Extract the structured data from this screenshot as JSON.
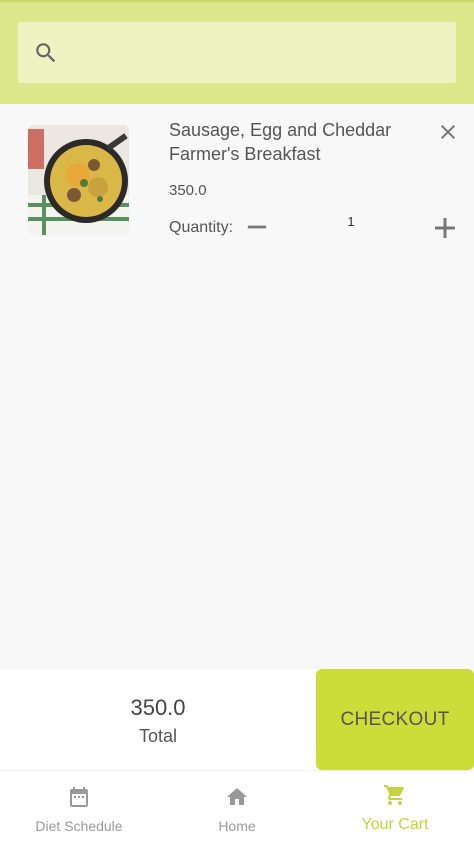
{
  "search": {
    "placeholder": "",
    "value": ""
  },
  "cart": {
    "items": [
      {
        "title": "Sausage, Egg and Cheddar Farmer's Breakfast",
        "price": "350.0",
        "quantity_label": "Quantity:",
        "quantity": "1"
      }
    ]
  },
  "checkout": {
    "total_amount": "350.0",
    "total_label": "Total",
    "button_label": "CHECKOUT"
  },
  "nav": {
    "items": [
      {
        "label": "Diet Schedule",
        "icon": "calendar-icon"
      },
      {
        "label": "Home",
        "icon": "home-icon"
      },
      {
        "label": "Your Cart",
        "icon": "cart-icon",
        "active": true
      }
    ]
  },
  "colors": {
    "header_bg": "#dde88c",
    "search_bg": "#eef3c1",
    "accent": "#cddc39",
    "active_nav": "#c5d33a"
  }
}
